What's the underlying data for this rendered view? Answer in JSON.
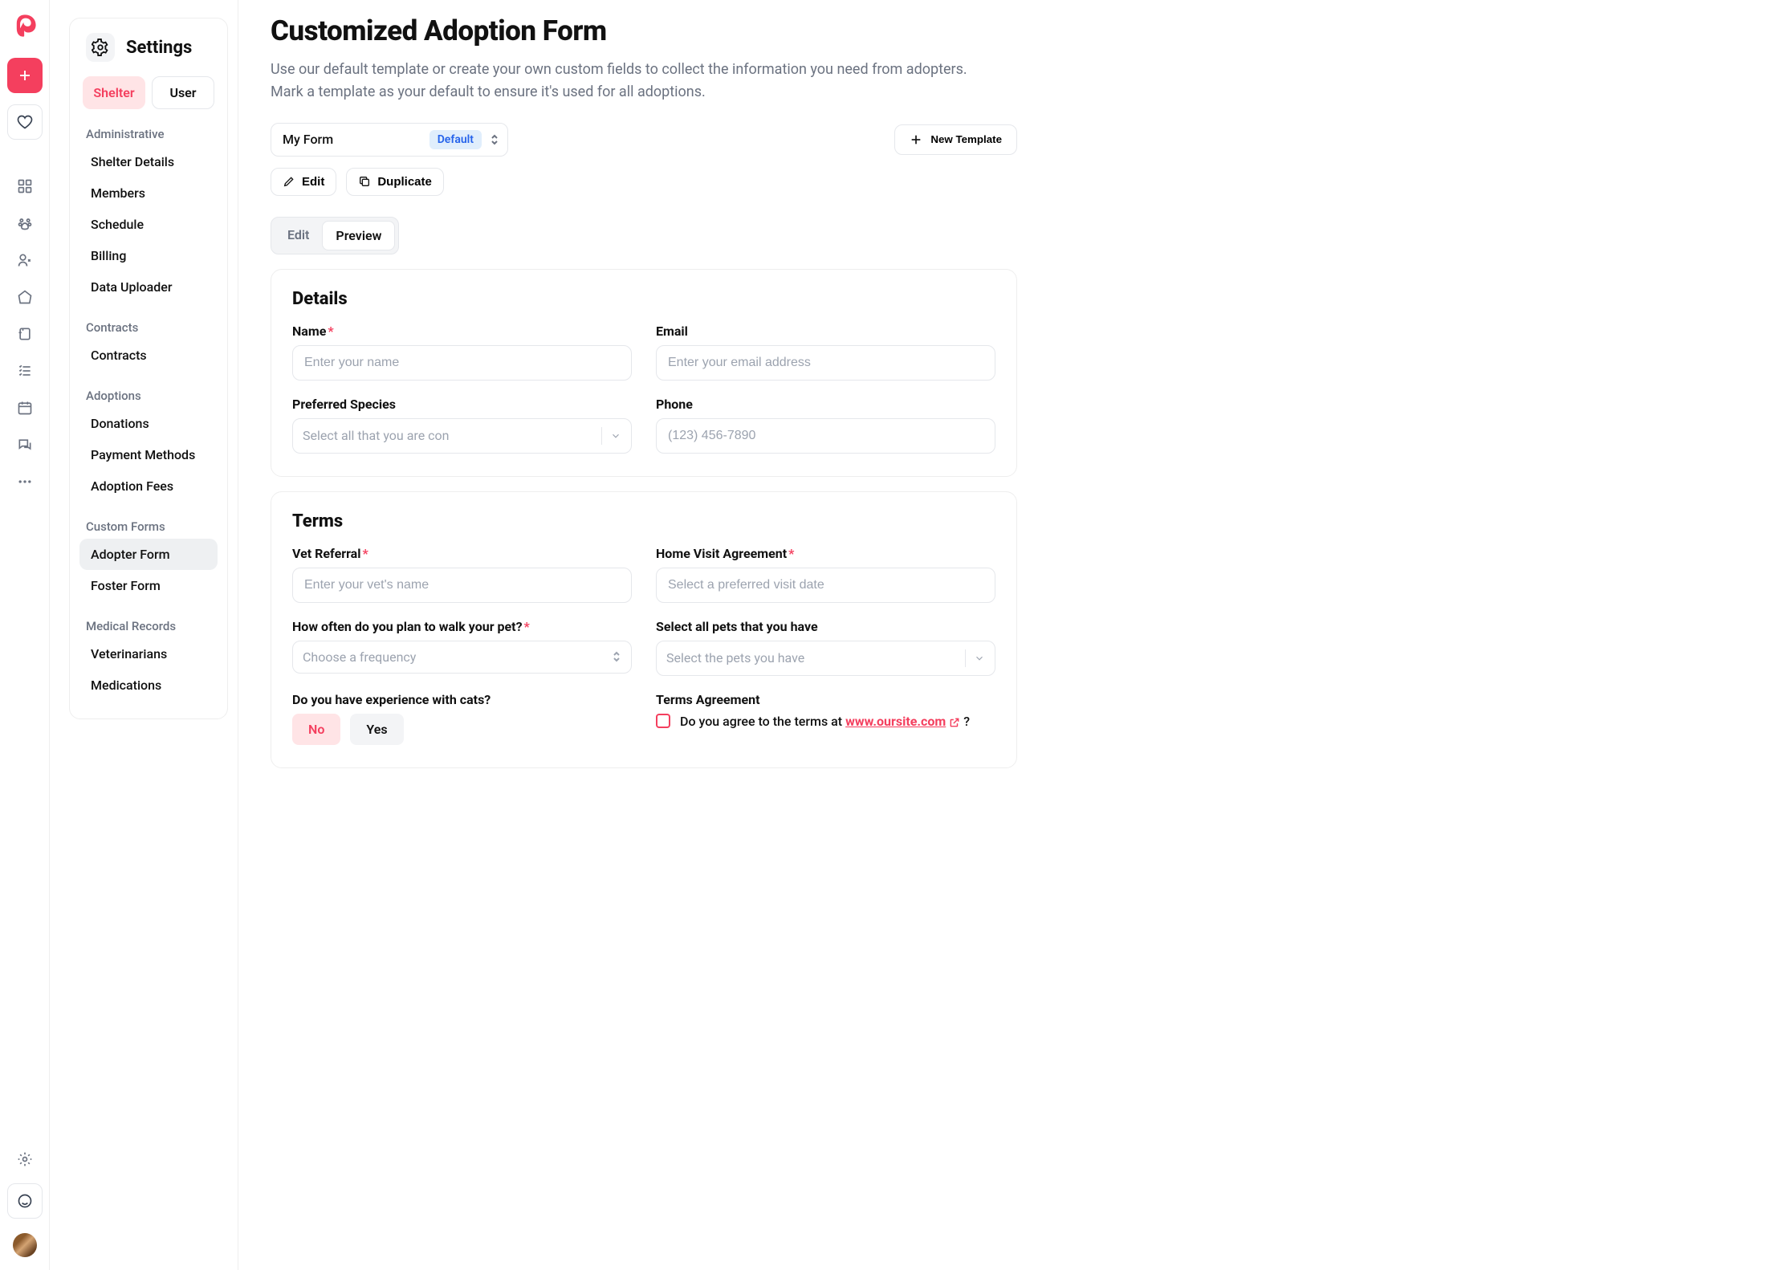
{
  "colors": {
    "accent": "#f43f5e",
    "blue": "#2563eb"
  },
  "rail": {},
  "sidebar": {
    "title": "Settings",
    "tabs": {
      "shelter": "Shelter",
      "user": "User"
    },
    "sections": {
      "administrative": {
        "label": "Administrative",
        "items": [
          "Shelter Details",
          "Members",
          "Schedule",
          "Billing",
          "Data Uploader"
        ]
      },
      "contracts": {
        "label": "Contracts",
        "items": [
          "Contracts"
        ]
      },
      "adoptions": {
        "label": "Adoptions",
        "items": [
          "Donations",
          "Payment Methods",
          "Adoption Fees"
        ]
      },
      "custom_forms": {
        "label": "Custom Forms",
        "items": [
          "Adopter Form",
          "Foster Form"
        ]
      },
      "medical": {
        "label": "Medical Records",
        "items": [
          "Veterinarians",
          "Medications"
        ]
      }
    }
  },
  "main": {
    "title": "Customized Adoption Form",
    "subtitle": "Use our default template or create your own custom fields to collect the information you need from adopters. Mark a template as your default to ensure it's used for all adoptions.",
    "template_name": "My Form",
    "default_badge": "Default",
    "new_template": "New Template",
    "edit_btn": "Edit",
    "duplicate_btn": "Duplicate",
    "mode_edit": "Edit",
    "mode_preview": "Preview"
  },
  "details": {
    "heading": "Details",
    "name_label": "Name",
    "name_ph": "Enter your name",
    "email_label": "Email",
    "email_ph": "Enter your email address",
    "species_label": "Preferred Species",
    "species_ph": "Select all that you are con",
    "phone_label": "Phone",
    "phone_ph": "(123) 456-7890"
  },
  "terms": {
    "heading": "Terms",
    "vet_label": "Vet Referral",
    "vet_ph": "Enter your vet's name",
    "visit_label": "Home Visit Agreement",
    "visit_ph": "Select a preferred visit date",
    "walk_label": "How often do you plan to walk your pet?",
    "walk_ph": "Choose a frequency",
    "pets_label": "Select all pets that you have",
    "pets_ph": "Select the pets you have",
    "cats_label": "Do you have experience with cats?",
    "no": "No",
    "yes": "Yes",
    "agree_label": "Terms Agreement",
    "agree_prefix": "Do you agree to the terms at ",
    "agree_link": "www.oursite.com",
    "agree_suffix": " ?"
  }
}
